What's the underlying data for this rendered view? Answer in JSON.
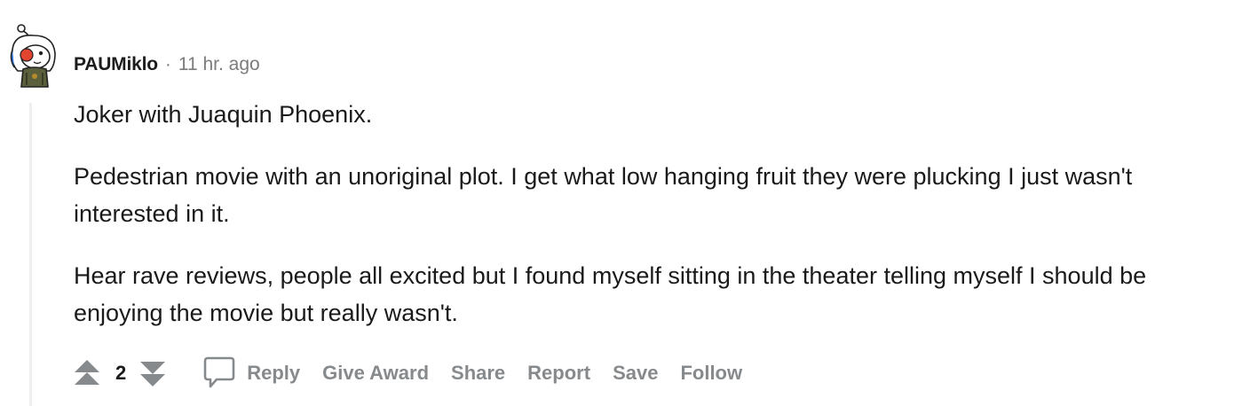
{
  "comment": {
    "author": "PAUMiklo",
    "separator": "·",
    "timestamp": "11 hr. ago",
    "avatar_icon": "snoo-avatar-icon",
    "paragraphs": [
      "Joker with Juaquin Phoenix.",
      "Pedestrian movie with an unoriginal plot. I get what low hanging fruit they were plucking I just wasn't interested in it.",
      "Hear rave reviews, people all excited but I found myself sitting in the theater telling myself I should be enjoying the movie but really wasn't."
    ],
    "score": "2"
  },
  "actions": {
    "upvote_icon": "upvote-arrow-icon",
    "downvote_icon": "downvote-arrow-icon",
    "comment_icon": "comment-bubble-icon",
    "reply": "Reply",
    "give_award": "Give Award",
    "share": "Share",
    "report": "Report",
    "save": "Save",
    "follow": "Follow"
  },
  "colors": {
    "text_primary": "#1a1a1b",
    "text_meta": "#7c7c7c",
    "action_gray": "#878a8c",
    "thread_line": "#edeff1"
  }
}
